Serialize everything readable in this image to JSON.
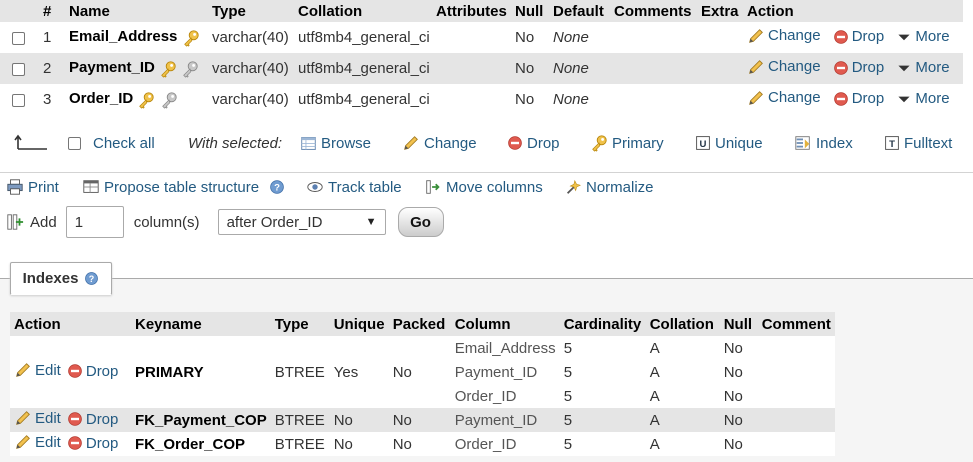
{
  "structure": {
    "headers": [
      "",
      "#",
      "Name",
      "Type",
      "Collation",
      "Attributes",
      "Null",
      "Default",
      "Comments",
      "Extra",
      "Action"
    ],
    "rows": [
      {
        "num": "1",
        "name": "Email_Address",
        "type": "varchar(40)",
        "collation": "utf8mb4_general_ci",
        "attributes": "",
        "null": "No",
        "default": "None",
        "comments": "",
        "extra": ""
      },
      {
        "num": "2",
        "name": "Payment_ID",
        "type": "varchar(40)",
        "collation": "utf8mb4_general_ci",
        "attributes": "",
        "null": "No",
        "default": "None",
        "comments": "",
        "extra": ""
      },
      {
        "num": "3",
        "name": "Order_ID",
        "type": "varchar(40)",
        "collation": "utf8mb4_general_ci",
        "attributes": "",
        "null": "No",
        "default": "None",
        "comments": "",
        "extra": ""
      }
    ],
    "actions": {
      "change": "Change",
      "drop": "Drop",
      "more": "More"
    }
  },
  "bulk": {
    "check_all": "Check all",
    "with_selected": "With selected:",
    "browse": "Browse",
    "change": "Change",
    "drop": "Drop",
    "primary": "Primary",
    "unique": "Unique",
    "index": "Index",
    "fulltext": "Fulltext"
  },
  "ops": {
    "print": "Print",
    "propose": "Propose table structure",
    "track": "Track table",
    "move": "Move columns",
    "normalize": "Normalize"
  },
  "add": {
    "label": "Add",
    "count": "1",
    "columns_label": "column(s)",
    "position": "after Order_ID",
    "go": "Go"
  },
  "indexes": {
    "tab_label": "Indexes",
    "headers": [
      "Action",
      "Keyname",
      "Type",
      "Unique",
      "Packed",
      "Column",
      "Cardinality",
      "Collation",
      "Null",
      "Comment"
    ],
    "edit": "Edit",
    "drop": "Drop",
    "primary": {
      "keyname": "PRIMARY",
      "type": "BTREE",
      "unique": "Yes",
      "packed": "No",
      "columns": [
        {
          "column": "Email_Address",
          "cardinality": "5",
          "collation": "A",
          "null": "No"
        },
        {
          "column": "Payment_ID",
          "cardinality": "5",
          "collation": "A",
          "null": "No"
        },
        {
          "column": "Order_ID",
          "cardinality": "5",
          "collation": "A",
          "null": "No"
        }
      ]
    },
    "fk_payment": {
      "keyname": "FK_Payment_COP",
      "type": "BTREE",
      "unique": "No",
      "packed": "No",
      "column": "Payment_ID",
      "cardinality": "5",
      "collation": "A",
      "null": "No"
    },
    "fk_order": {
      "keyname": "FK_Order_COP",
      "type": "BTREE",
      "unique": "No",
      "packed": "No",
      "column": "Order_ID",
      "cardinality": "5",
      "collation": "A",
      "null": "No"
    }
  },
  "colors": {
    "link": "#235a81",
    "header_bg": "#e5e5e5",
    "drop_red": "#d9534f",
    "key_gold": "#e2b13c"
  }
}
